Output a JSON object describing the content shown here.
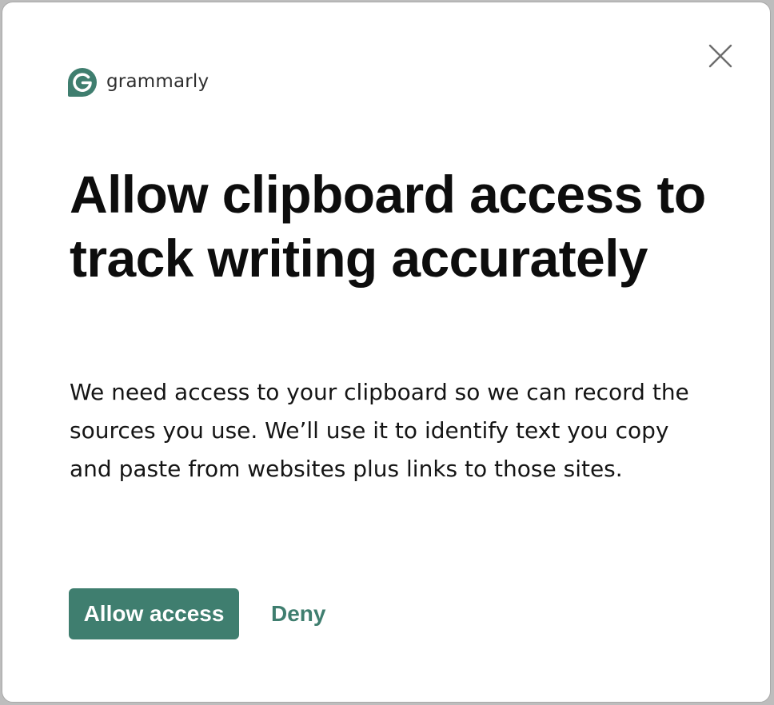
{
  "brand": {
    "name": "grammarly",
    "logo_icon": "grammarly-logo-icon",
    "color": "#3f7e6f"
  },
  "dialog": {
    "title": "Allow clipboard access to track writing accurately",
    "body": "We need access to your clipboard so we can record the sources you use. We’ll use it to identify text you copy and paste from websites plus links to those sites.",
    "close_icon": "close-icon"
  },
  "actions": {
    "allow_label": "Allow access",
    "deny_label": "Deny"
  }
}
